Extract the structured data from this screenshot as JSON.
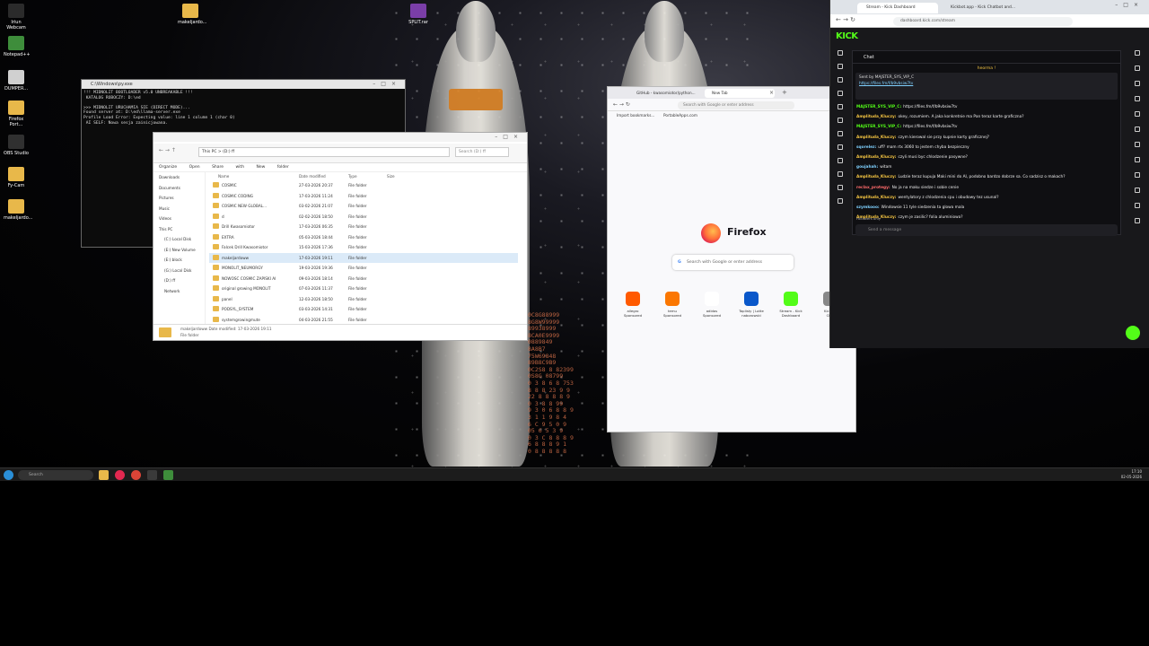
{
  "desktop": {
    "icons": [
      {
        "label": "Iriun Webcam",
        "color": "#2b2b2b"
      },
      {
        "label": "Notepad++",
        "color": "#3e8d3b"
      },
      {
        "label": "DUMPER...",
        "color": "#d0d0d0"
      },
      {
        "label": "Firefox Port...",
        "color": "#e8b84a"
      },
      {
        "label": "OBS Studio",
        "color": "#303030"
      },
      {
        "label": "Fy-Cam",
        "color": "#e8b84a"
      },
      {
        "label": "makeljardo...",
        "color": "#e8b84a"
      }
    ],
    "top_icons": [
      {
        "label": "makeljardo...",
        "color": "#e8b84a"
      },
      {
        "label": "SPLIT.rar",
        "color": "#7a3ea8"
      }
    ],
    "digits": "0C8G88999\n8G8W99999\n89938999\n8CA0E9999\n0889849\n8A8B7\n75W69848\n89B8C9B9\n0C2S8 8 82399\n0S8G 08799\n0 3 8 6 8 753\n8 8 8 23 9 9\n22 8 8 8 8 9\n0 3 8 8 99\n9 3 0 6 8 8 9\n3 1 1 9 8 4\n6 C 9 5 0 9\n05 6 5 3 9\n0 3 C 8 8 8 9\n6 8 8 8 9 1\n0 8 8 8 8 8"
  },
  "cmd": {
    "title": "C:\\Windows\\py.exe",
    "lines": "!!! MIDNOLIT BOOTLOADER v5.0 UNBREAKABLE !!!\n KATALOG ROBOCZY: D:\\ed\n\n>>> MIDNOLIT URUCHAMIA SIE (DIRECT MODE)...\nFound server at: D:\\ed\\llama-server.exe\nProfile Load Error: Expecting value: line 1 column 1 (char 0)\n AI SELF: Nowa sesja zainicjowana."
  },
  "explorer": {
    "path": "This PC  >  (D:) ff",
    "search": "Search (D:) ff",
    "commands": [
      "Organize",
      "Open",
      "Share with",
      "New folder"
    ],
    "nav": [
      "Downloads",
      "Documents",
      "Pictures",
      "Music",
      "Videos",
      "",
      "This PC",
      "(C:) Local Disk",
      "(E:) New Volume",
      "(E:) block",
      "(G:) Local Disk",
      "(D:) ff",
      "Network"
    ],
    "columns": [
      "Name",
      "Date modified",
      "Type",
      "Size"
    ],
    "rows": [
      {
        "name": "COSMIC",
        "date": "27-03-2026 20:37",
        "type": "File folder"
      },
      {
        "name": "COSMIC CODING",
        "date": "17-03-2026 11:24",
        "type": "File folder"
      },
      {
        "name": "COSMIC NEW GLOBAL...",
        "date": "03-02-2026 21:07",
        "type": "File folder"
      },
      {
        "name": "d",
        "date": "02-02-2026 18:50",
        "type": "File folder"
      },
      {
        "name": "Drill Kwasomiotor",
        "date": "17-03-2026 06:35",
        "type": "File folder"
      },
      {
        "name": "EXTRA",
        "date": "05-03-2026 18:44",
        "type": "File folder"
      },
      {
        "name": "Falcek Drill Kwasomiotor",
        "date": "15-03-2026 17:36",
        "type": "File folder"
      },
      {
        "name": "makeljardoww",
        "date": "17-03-2026 19:11",
        "type": "File folder"
      },
      {
        "name": "MONOLIT_NEUMORGY",
        "date": "19-03-2026 19:36",
        "type": "File folder"
      },
      {
        "name": "NOWOSC COSMIC ZAPISKI AI",
        "date": "09-03-2026 18:14",
        "type": "File folder"
      },
      {
        "name": "original growing MONOLIT",
        "date": "07-03-2026 11:37",
        "type": "File folder"
      },
      {
        "name": "panel",
        "date": "12-03-2026 18:50",
        "type": "File folder"
      },
      {
        "name": "PODSYL_SYSTEM",
        "date": "03-03-2026 14:31",
        "type": "File folder"
      },
      {
        "name": "systemgrowingmute",
        "date": "04-03-2026 21:55",
        "type": "File folder"
      }
    ],
    "status_name": "makeljardoww  Date modified: 17-03-2026 19:11",
    "status_type": "File folder"
  },
  "firefox": {
    "tabs": [
      "GitHub - kwasomiotor/python...",
      "New Tab"
    ],
    "url_placeholder": "Search with Google or enter address",
    "bookmarks": [
      "Import bookmarks...",
      "PortableApps.com"
    ],
    "brand": "Firefox",
    "search_placeholder": "Search with Google or enter address",
    "shortcuts": [
      {
        "label": "allegro\nSponsored",
        "color": "#ff5a00"
      },
      {
        "label": "temu\nSponsored",
        "color": "#fb7701"
      },
      {
        "label": "adidas\nSponsored",
        "color": "#ffffff"
      },
      {
        "label": "Toplisty | Lotte\nnaborowski",
        "color": "#0a58ca"
      },
      {
        "label": "Stream - Kick\nDashboard",
        "color": "#53fc18"
      },
      {
        "label": "Kickbot\nChat",
        "color": "#888888"
      }
    ]
  },
  "browser": {
    "tabs": [
      "Stream - Kick Dashboard",
      "Kickbot.app - Kick Chatbot and..."
    ],
    "url": "dashboard.kick.com/stream",
    "logo": "KICK",
    "chat_title": "Chat",
    "hype": "heorma !",
    "pinned": {
      "line1": "Sent by  MAJSTER_SYS_VIP_C",
      "link": "https://files.fm/f/b9vbsiw7tv"
    },
    "messages": [
      {
        "user": "MAJSTER_SYS_VIP_C:",
        "text": "https://files.fm/f/b9vbsiw7tv",
        "color": "#53fc18"
      },
      {
        "user": "Amplituda_Kluczy:",
        "text": "okey, rozumiem. A jaka konkretnie ma Pan teraz karte graficzna?",
        "color": "#f5c542"
      },
      {
        "user": "MAJSTER_SYS_VIP_C:",
        "text": "https://files.fm/f/b9vbsiw7tv",
        "color": "#53fc18"
      },
      {
        "user": "Amplituda_Kluczy:",
        "text": "czym kierowal sie przy kupnie karty graficznej?",
        "color": "#f5c542"
      },
      {
        "user": "sqorelez:",
        "text": "uff? mam rtx 3060 to jestem chyba bezpieczny",
        "color": "#7fd1ff"
      },
      {
        "user": "Amplituda_Kluczy:",
        "text": "czyli musi byc chlodzenie pasywne?",
        "color": "#f5c542"
      },
      {
        "user": "goujahah:",
        "text": "witam",
        "color": "#7fd1ff"
      },
      {
        "user": "Amplituda_Kluczy:",
        "text": "Ludzie teraz kupuja Maki mini do AI, podobno bardzo dobrze sa. Co sadzisz o makach?",
        "color": "#f5c542"
      },
      {
        "user": "reclax_protegy:",
        "text": "No ja na maku siedze i sobie cenie",
        "color": "#ff6b6b"
      },
      {
        "user": "Amplituda_Kluczy:",
        "text": "wentylatory z chlodzenia cpu i obudowy tez usunal?",
        "color": "#f5c542"
      },
      {
        "user": "szymkooo:",
        "text": "Windowsie 11 tyle siedzenia ta glowa mala",
        "color": "#7fd1ff"
      },
      {
        "user": "Amplituda_Kluczy:",
        "text": "czym je zasilic? folia aluminiowa?",
        "color": "#f5c542"
      }
    ],
    "followers": "Followers only",
    "input_placeholder": "Send a message"
  },
  "taskbar": {
    "search": "Search",
    "time": "17:10",
    "date": "02-05-2026"
  }
}
